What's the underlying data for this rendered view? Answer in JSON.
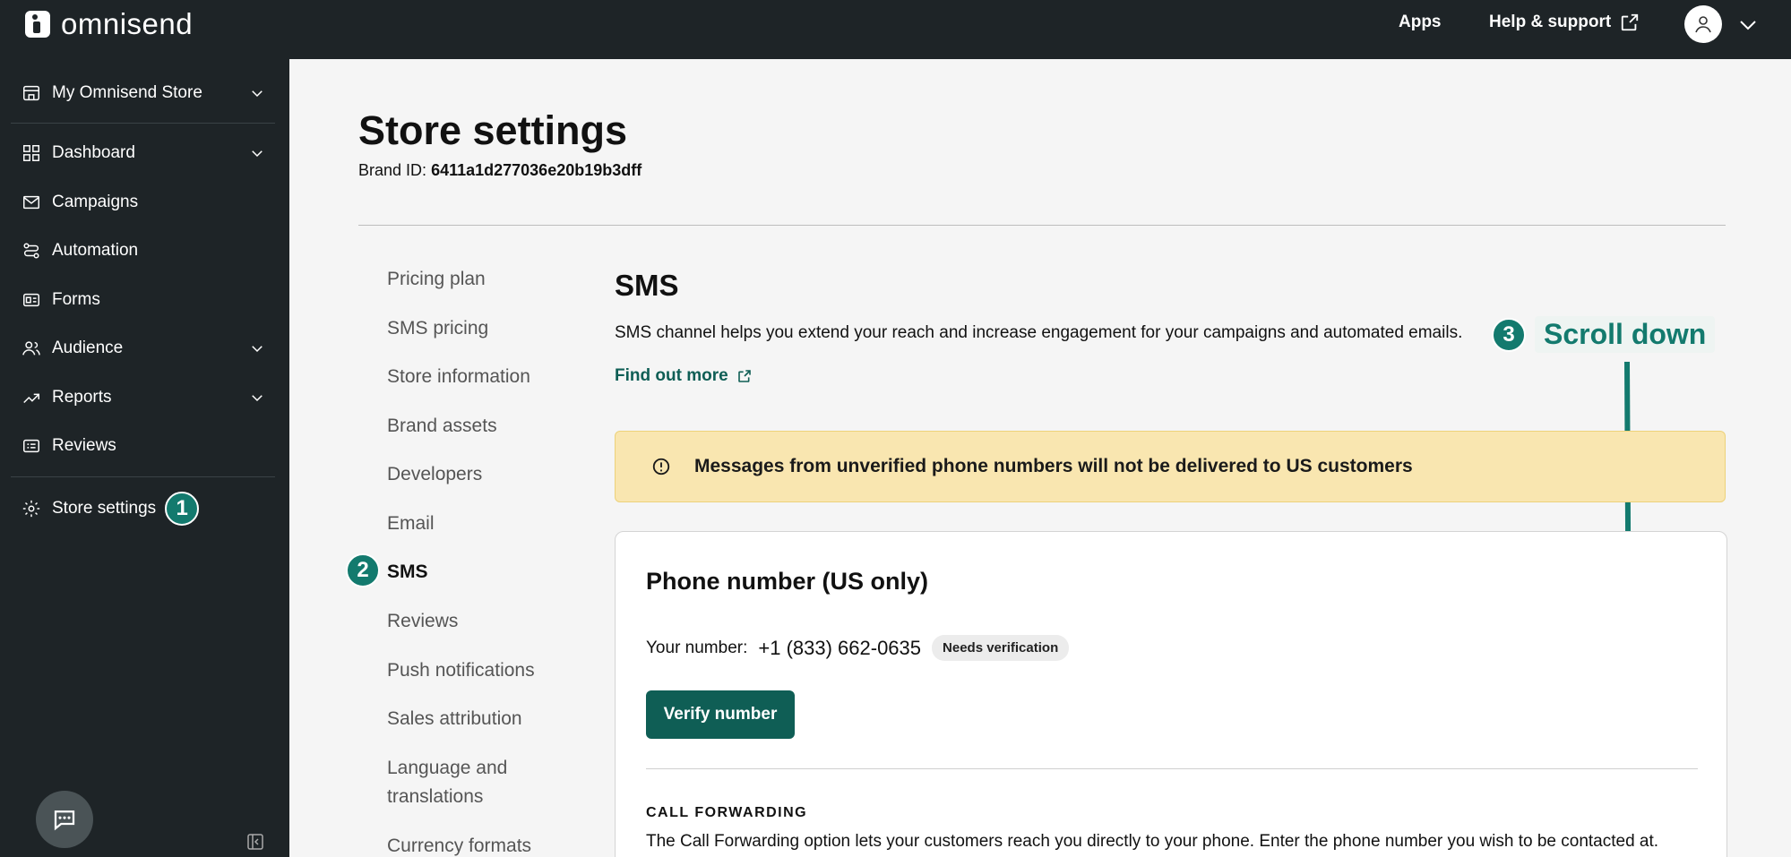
{
  "topbar": {
    "brand": "omnisend",
    "apps_label": "Apps",
    "help_label": "Help & support"
  },
  "sidebar": {
    "store_selector": "My Omnisend Store",
    "items": [
      {
        "label": "Dashboard",
        "icon": "dashboard-icon"
      },
      {
        "label": "Campaigns",
        "icon": "mail-icon"
      },
      {
        "label": "Automation",
        "icon": "automation-icon"
      },
      {
        "label": "Forms",
        "icon": "forms-icon"
      },
      {
        "label": "Audience",
        "icon": "audience-icon"
      },
      {
        "label": "Reports",
        "icon": "reports-icon"
      },
      {
        "label": "Reviews",
        "icon": "reviews-icon"
      }
    ],
    "store_settings": "Store settings",
    "step1": "1"
  },
  "main": {
    "title": "Store settings",
    "brand_id_label": "Brand ID:",
    "brand_id_value": "6411a1d277036e20b19b3dff",
    "subnav": [
      "Pricing plan",
      "SMS pricing",
      "Store information",
      "Brand assets",
      "Developers",
      "Email",
      "SMS",
      "Reviews",
      "Push notifications",
      "Sales attribution",
      "Language and",
      "translations",
      "Currency formats"
    ],
    "step2": "2",
    "sms": {
      "title": "SMS",
      "description": "SMS channel helps you extend your reach and increase engagement for your campaigns and automated emails.",
      "find_out_more": "Find out more",
      "step3": "3",
      "scroll_down": "Scroll down",
      "alert": "Messages from unverified phone numbers will not be delivered to US customers",
      "card": {
        "title": "Phone number (US only)",
        "your_number_label": "Your number:",
        "your_number_value": "+1 (833) 662-0635",
        "status": "Needs verification",
        "verify_button": "Verify number",
        "call_forwarding_title": "CALL FORWARDING",
        "call_forwarding_desc": "The Call Forwarding option lets your customers reach you directly to your phone. Enter the phone number you wish to be contacted at."
      }
    }
  },
  "colors": {
    "dark_bg": "#1e2427",
    "accent_teal": "#137a6e",
    "button_teal": "#0f5e55",
    "alert_bg": "#f9e6b0"
  }
}
